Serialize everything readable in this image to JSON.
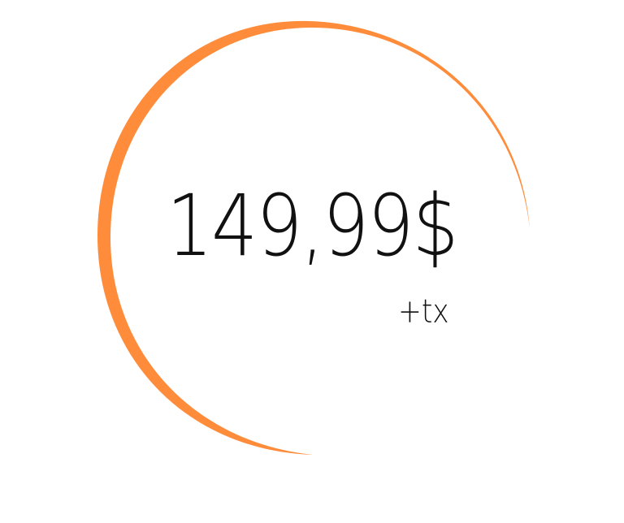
{
  "price": {
    "amount": "149,99$",
    "tax_note": "+tx"
  },
  "colors": {
    "accent": "#FF8C3A",
    "text": "#111111",
    "background": "#FFFFFF"
  }
}
